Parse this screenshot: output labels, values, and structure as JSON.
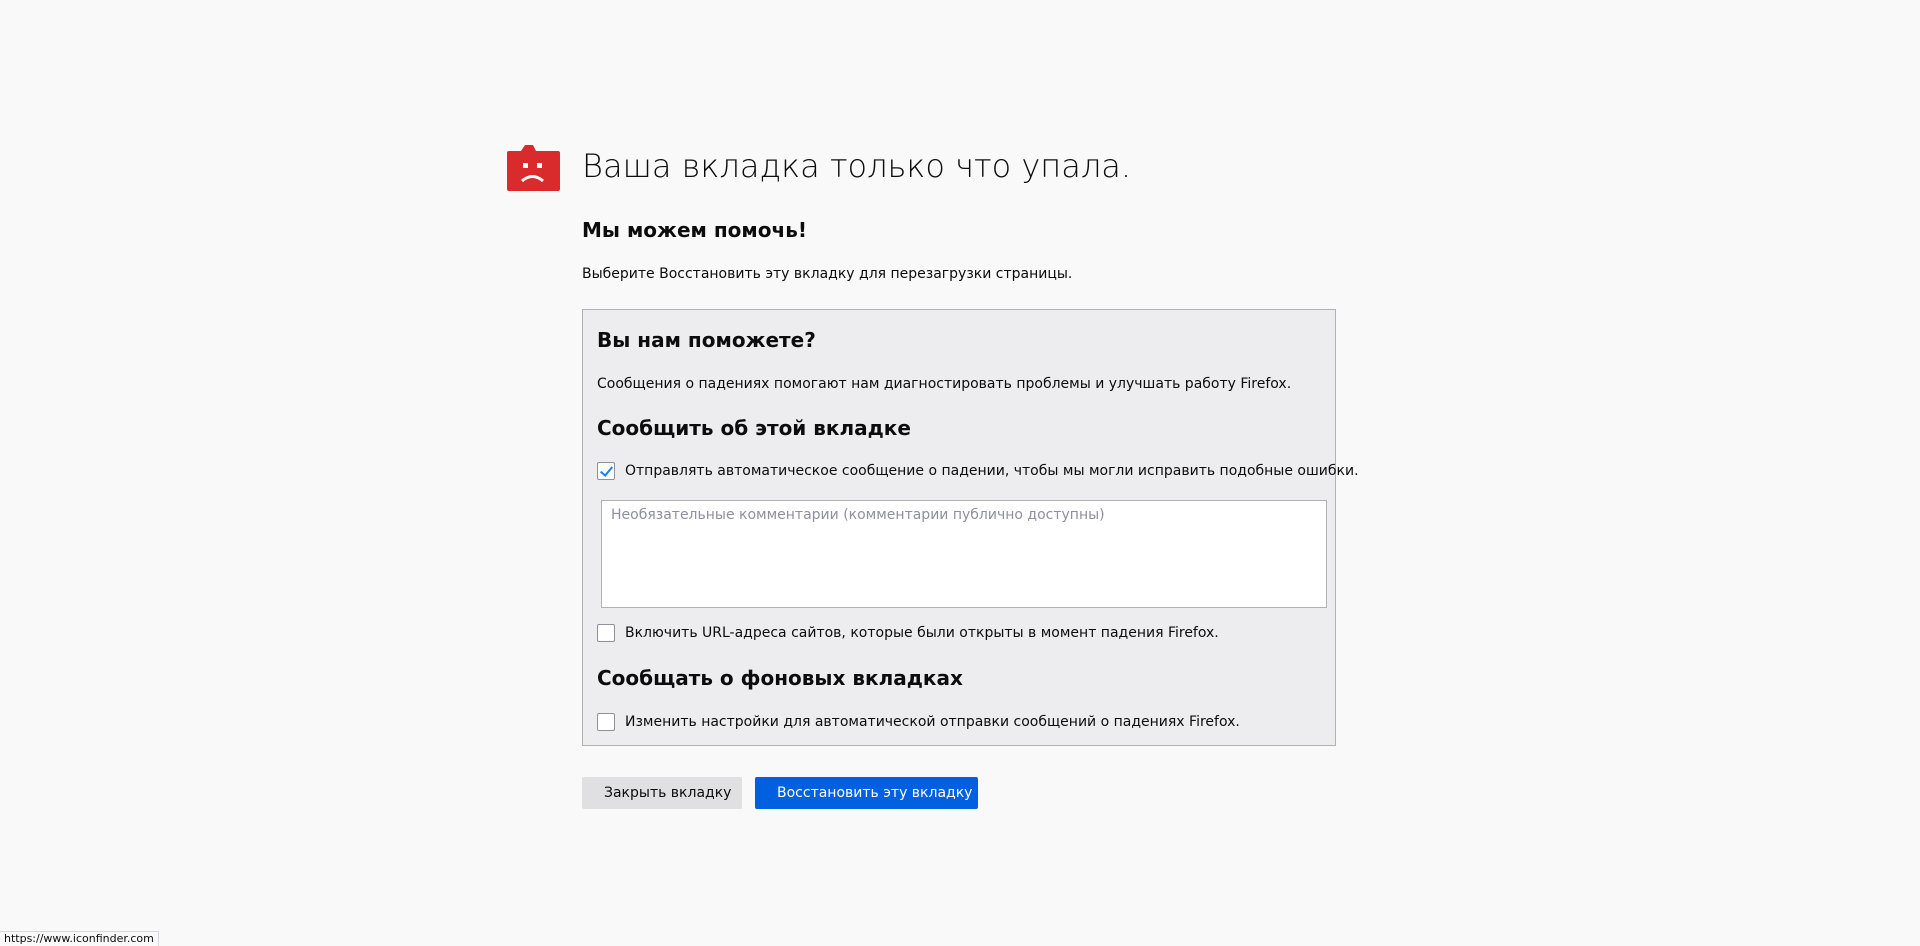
{
  "header": {
    "icon": "sad-tab-icon",
    "icon_color": "#d92b2b",
    "title": "Ваша вкладка только что упала."
  },
  "help": {
    "heading": "Мы можем помочь!",
    "text": "Выберите Восстановить эту вкладку для перезагрузки страницы."
  },
  "report": {
    "heading": "Вы нам поможете?",
    "text": "Сообщения о падениях помогают нам диагностировать проблемы и улучшать работу Firefox.",
    "tab_section": {
      "heading": "Сообщить об этой вкладке",
      "send_report": {
        "label": "Отправлять автоматическое сообщение о падении, чтобы мы могли исправить подобные ошибки.",
        "checked": true
      },
      "comments_placeholder": "Необязательные комментарии (комментарии публично доступны)",
      "include_urls": {
        "label": "Включить URL-адреса сайтов, которые были открыты в момент падения Firefox.",
        "checked": false
      }
    },
    "background_section": {
      "heading": "Сообщать о фоновых вкладках",
      "auto_submit": {
        "label": "Изменить настройки для автоматической отправки сообщений о падениях Firefox.",
        "checked": false
      }
    }
  },
  "buttons": {
    "close_label": "Закрыть вкладку",
    "restore_label": "Восстановить эту вкладку",
    "restore_color": "#0060df"
  },
  "status_bar": {
    "url": "https://www.iconfinder.com"
  }
}
